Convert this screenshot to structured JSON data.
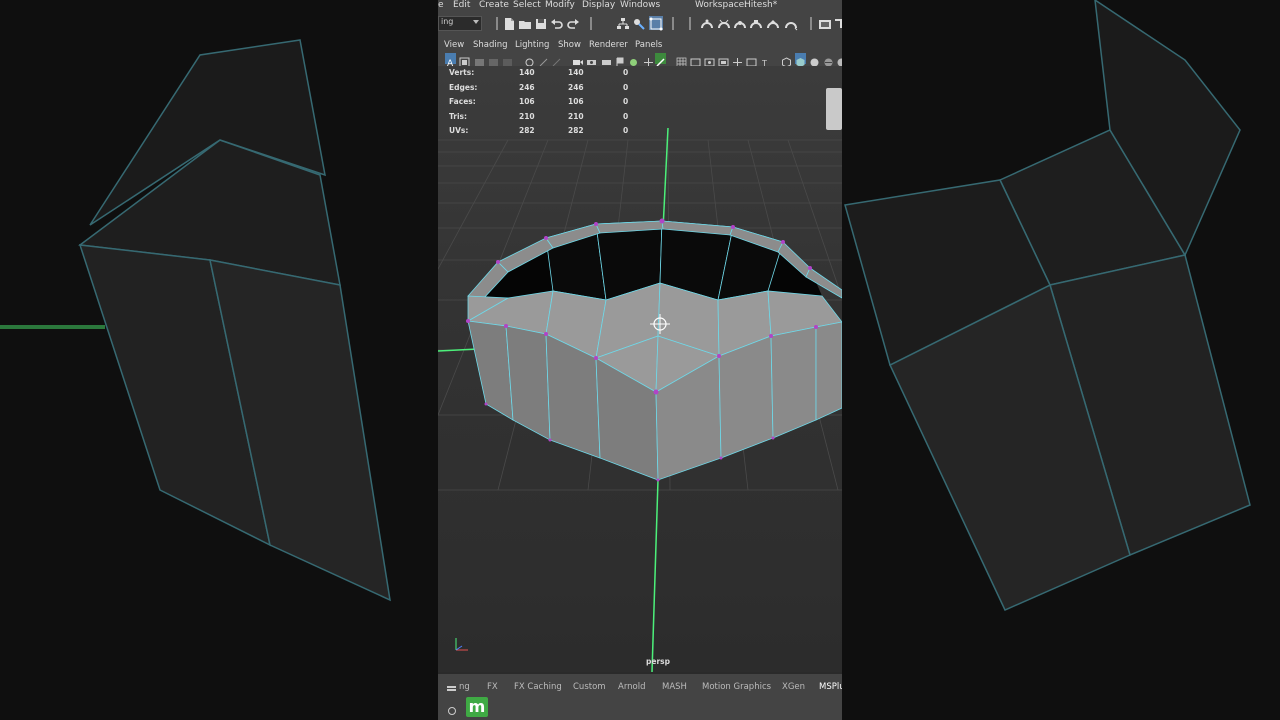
{
  "menubar": {
    "items": [
      "e",
      "Edit",
      "Create",
      "Select",
      "Modify",
      "Display",
      "Windows"
    ],
    "workspace_label": "Workspace:",
    "workspace_value": "Hitesh*"
  },
  "statusline": {
    "mode_value": "ing"
  },
  "panel_menu": {
    "items": [
      "View",
      "Shading",
      "Lighting",
      "Show",
      "Renderer",
      "Panels"
    ]
  },
  "hud_stats": {
    "rows": [
      {
        "label": "Verts:",
        "col1": "140",
        "col2": "140",
        "col3": "0"
      },
      {
        "label": "Edges:",
        "col1": "246",
        "col2": "246",
        "col3": "0"
      },
      {
        "label": "Faces:",
        "col1": "106",
        "col2": "106",
        "col3": "0"
      },
      {
        "label": "Tris:",
        "col1": "210",
        "col2": "210",
        "col3": "0"
      },
      {
        "label": "UVs:",
        "col1": "282",
        "col2": "282",
        "col3": "0"
      }
    ]
  },
  "viewport": {
    "camera_label": "persp"
  },
  "shelf": {
    "tabs": [
      "ng",
      "FX",
      "FX Caching",
      "Custom",
      "Arnold",
      "MASH",
      "Motion Graphics",
      "XGen",
      "MSPlu"
    ],
    "active_tab": "MSPlu",
    "plugin_button_label": "m"
  },
  "colors": {
    "wireframe": "#6fd8e8",
    "vertex": "#b044c8",
    "y_axis": "#4cf07a",
    "plugin_green": "#3faa44"
  }
}
